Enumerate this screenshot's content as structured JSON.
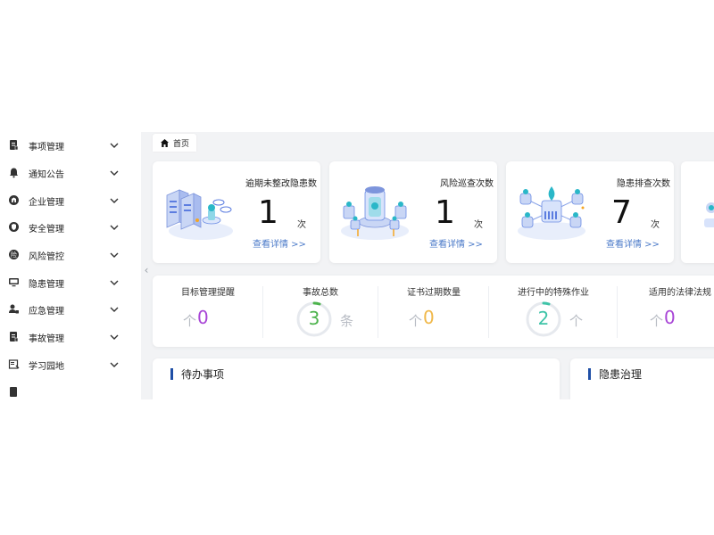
{
  "sidebar": {
    "items": [
      {
        "label": "事项管理",
        "icon": "document-icon"
      },
      {
        "label": "通知公告",
        "icon": "bell-icon"
      },
      {
        "label": "企业管理",
        "icon": "building-icon"
      },
      {
        "label": "安全管理",
        "icon": "shield-icon"
      },
      {
        "label": "风险管控",
        "icon": "risk-icon"
      },
      {
        "label": "隐患管理",
        "icon": "monitor-icon"
      },
      {
        "label": "应急管理",
        "icon": "user-lock-icon"
      },
      {
        "label": "事故管理",
        "icon": "document-icon"
      },
      {
        "label": "学习园地",
        "icon": "book-icon"
      },
      {
        "label": "",
        "icon": "document-icon"
      }
    ]
  },
  "tab": {
    "label": "首页",
    "icon": "home-icon"
  },
  "collapse": {
    "icon": "chevron-left-icon",
    "glyph": "‹"
  },
  "stat_cards": [
    {
      "title": "逾期未整改隐患数",
      "value": "1",
      "unit": "次",
      "link": "查看详情 >>",
      "illustration": "server-rack-illustration"
    },
    {
      "title": "风险巡查次数",
      "value": "1",
      "unit": "次",
      "link": "查看详情 >>",
      "illustration": "reactor-illustration"
    },
    {
      "title": "隐患排查次数",
      "value": "7",
      "unit": "次",
      "link": "查看详情 >>",
      "illustration": "network-illustration"
    }
  ],
  "metrics": [
    {
      "title": "目标管理提醒",
      "unit": "个",
      "value": "0",
      "color": "#a845d6"
    },
    {
      "title": "事故总数",
      "unit": "条",
      "value": "3",
      "color": "#4cb34c",
      "style": "ring",
      "ring_color": "#4cb34c"
    },
    {
      "title": "证书过期数量",
      "unit": "个",
      "value": "0",
      "color": "#f0b84a"
    },
    {
      "title": "进行中的特殊作业",
      "unit": "个",
      "value": "2",
      "color": "#3fc4a8",
      "style": "ring",
      "ring_color": "#3fc4a8"
    },
    {
      "title": "适用的法律法规",
      "unit": "个",
      "value": "0",
      "color": "#a845d6"
    }
  ],
  "panels": [
    {
      "title": "待办事项"
    },
    {
      "title": "隐患治理"
    }
  ],
  "colors": {
    "accent": "#1f4fa6",
    "link": "#4a79c8",
    "background": "#f2f3f5"
  }
}
